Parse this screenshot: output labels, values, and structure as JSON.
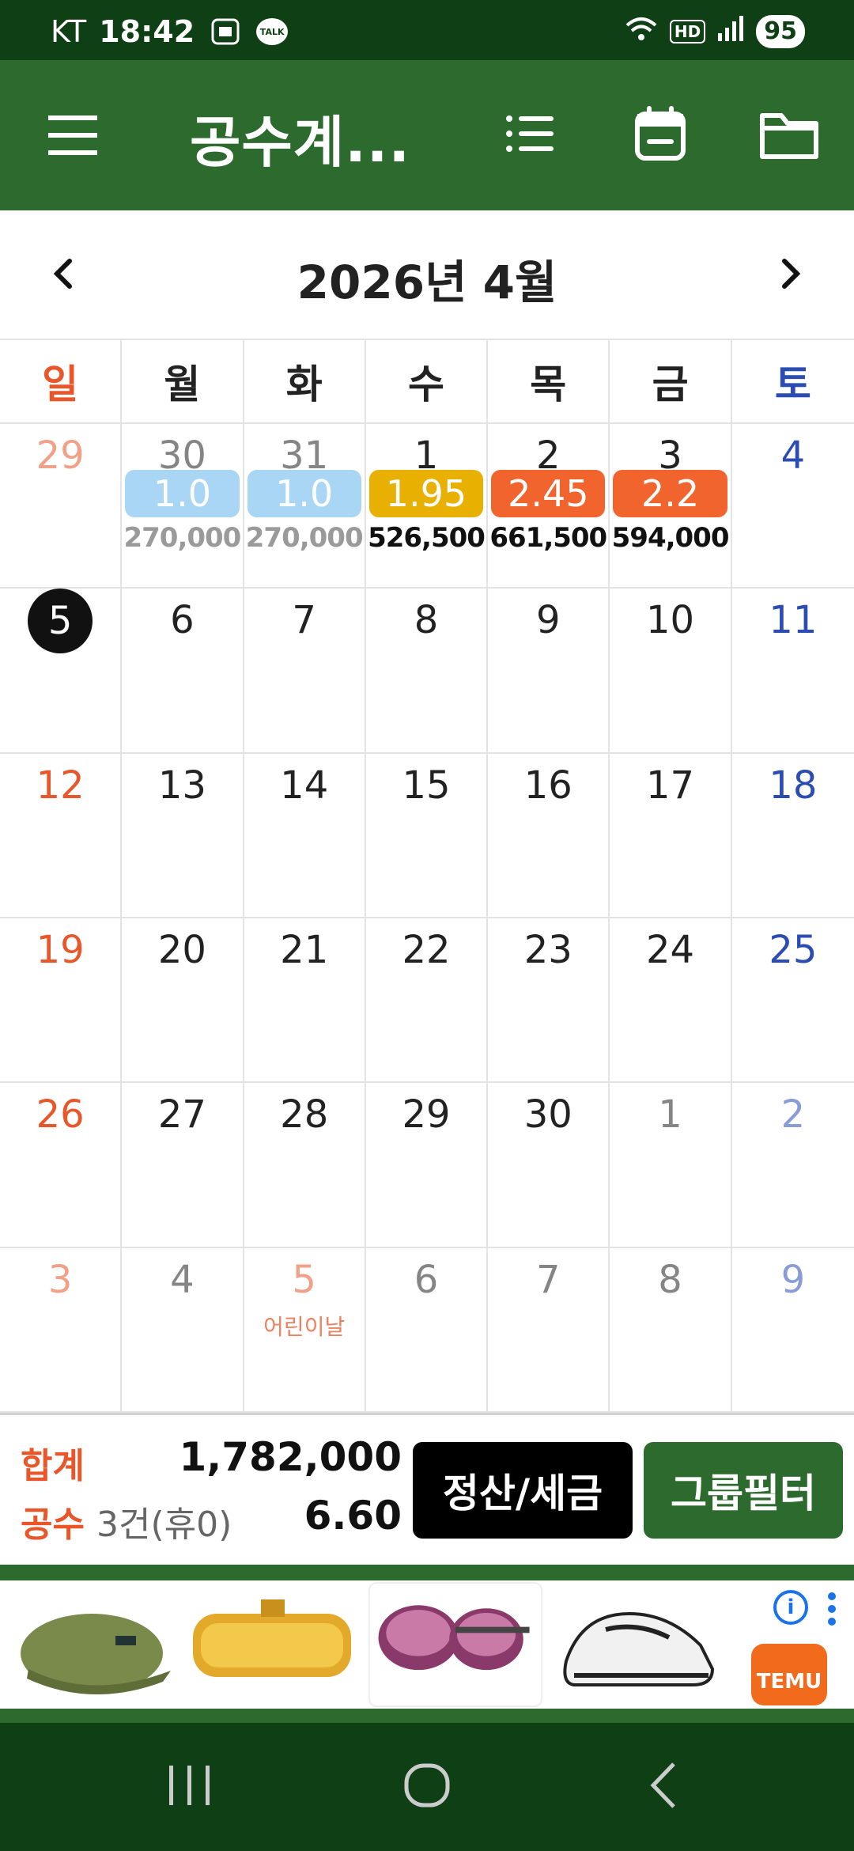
{
  "status_bar": {
    "carrier": "KT",
    "time": "18:42",
    "talk_label": "TALK",
    "hd_label": "HD",
    "battery": "95"
  },
  "app_bar": {
    "title": "공수계..."
  },
  "calendar": {
    "month_title": "2026년 4월",
    "weekdays": [
      "일",
      "월",
      "화",
      "수",
      "목",
      "금",
      "토"
    ],
    "weeks": [
      [
        {
          "day": "29",
          "other": true
        },
        {
          "day": "30",
          "other": true,
          "badge": "1.0",
          "badge_color": "#a9d6f5",
          "amount": "270,000",
          "amount_faded": true
        },
        {
          "day": "31",
          "other": true,
          "badge": "1.0",
          "badge_color": "#a9d6f5",
          "amount": "270,000",
          "amount_faded": true
        },
        {
          "day": "1",
          "badge": "1.95",
          "badge_color": "#e8b000",
          "amount": "526,500"
        },
        {
          "day": "2",
          "badge": "2.45",
          "badge_color": "#f2642d",
          "amount": "661,500"
        },
        {
          "day": "3",
          "badge": "2.2",
          "badge_color": "#f2642d",
          "amount": "594,000"
        },
        {
          "day": "4"
        }
      ],
      [
        {
          "day": "5",
          "today": true
        },
        {
          "day": "6"
        },
        {
          "day": "7"
        },
        {
          "day": "8"
        },
        {
          "day": "9"
        },
        {
          "day": "10"
        },
        {
          "day": "11"
        }
      ],
      [
        {
          "day": "12"
        },
        {
          "day": "13"
        },
        {
          "day": "14"
        },
        {
          "day": "15"
        },
        {
          "day": "16"
        },
        {
          "day": "17"
        },
        {
          "day": "18"
        }
      ],
      [
        {
          "day": "19"
        },
        {
          "day": "20"
        },
        {
          "day": "21"
        },
        {
          "day": "22"
        },
        {
          "day": "23"
        },
        {
          "day": "24"
        },
        {
          "day": "25"
        }
      ],
      [
        {
          "day": "26"
        },
        {
          "day": "27"
        },
        {
          "day": "28"
        },
        {
          "day": "29"
        },
        {
          "day": "30"
        },
        {
          "day": "1",
          "other": true
        },
        {
          "day": "2",
          "other": true
        }
      ],
      [
        {
          "day": "3",
          "other": true
        },
        {
          "day": "4",
          "other": true
        },
        {
          "day": "5",
          "other": true,
          "holiday": "어린이날",
          "holiday_day": true
        },
        {
          "day": "6",
          "other": true
        },
        {
          "day": "7",
          "other": true
        },
        {
          "day": "8",
          "other": true
        },
        {
          "day": "9",
          "other": true
        }
      ]
    ]
  },
  "summary": {
    "total_label": "합계",
    "total_value": "1,782,000",
    "count_label": "공수",
    "count_text": "3건(휴0)",
    "count_value": "6.60",
    "settle_button": "정산/세금",
    "group_button": "그룹필터"
  },
  "ad": {
    "brand": "TEMU",
    "info_label": "i",
    "products": [
      "cap",
      "gold-bracelet",
      "sunglasses",
      "sneakers"
    ]
  },
  "colors": {
    "primary": "#2c6a2e",
    "status_bar": "#0f3f14",
    "sunday": "#e8562a",
    "saturday": "#2b4db3"
  }
}
